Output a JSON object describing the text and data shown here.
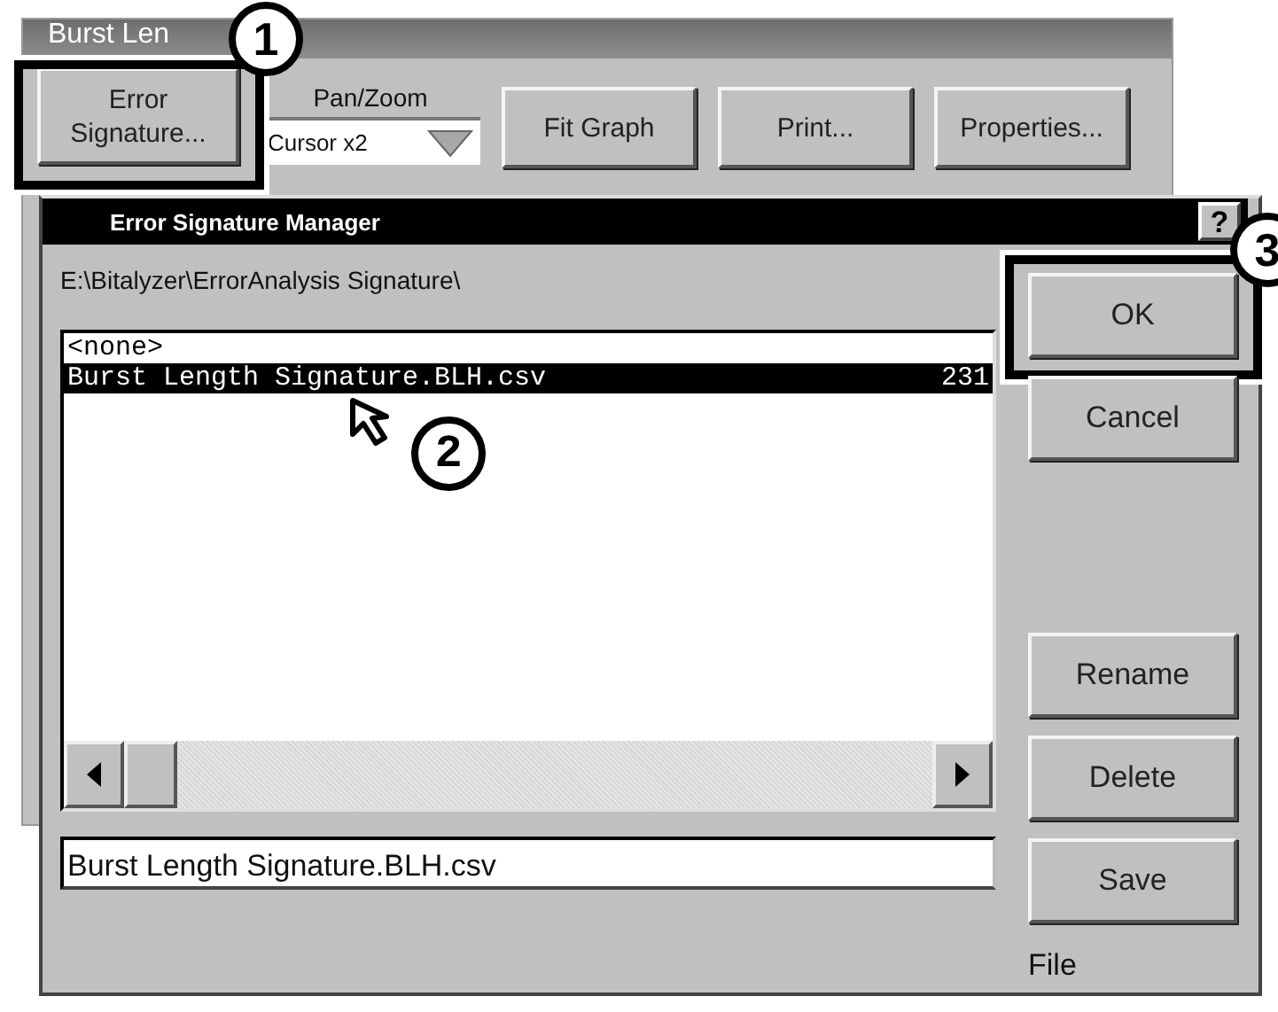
{
  "back_window": {
    "title": "Burst Len",
    "error_button": {
      "label": "Error Signature...",
      "callout": "1"
    },
    "pan_zoom": {
      "label": "Pan/Zoom",
      "value": "Cursor x2"
    },
    "buttons": [
      {
        "label": "Fit Graph"
      },
      {
        "label": "Print..."
      },
      {
        "label": "Properties..."
      }
    ]
  },
  "dialog": {
    "title": "Error Signature Manager",
    "help": "?",
    "path": "E:\\Bitalyzer\\ErrorAnalysis Signature\\",
    "files": [
      {
        "name": "<none>",
        "selected": false
      },
      {
        "name": "Burst Length Signature.BLH.csv",
        "size": "231",
        "selected": true,
        "callout": "2"
      }
    ],
    "top_buttons": [
      {
        "label": "OK",
        "callout": "3"
      },
      {
        "label": "Cancel"
      }
    ],
    "bottom_buttons": [
      {
        "label": "Rename"
      },
      {
        "label": "Delete"
      },
      {
        "label": "Save"
      }
    ],
    "file_name": "Burst Length Signature.BLH.csv",
    "file_label": "File"
  }
}
